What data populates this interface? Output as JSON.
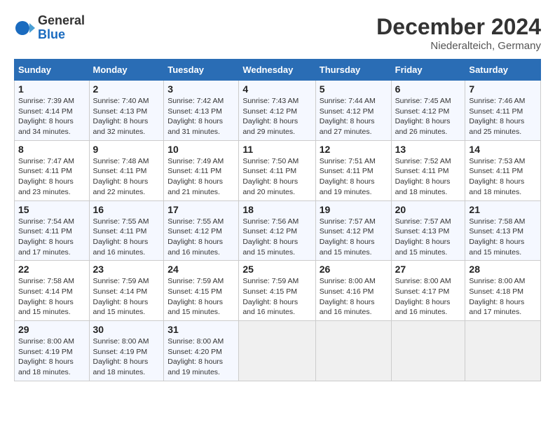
{
  "header": {
    "logo_general": "General",
    "logo_blue": "Blue",
    "month_year": "December 2024",
    "location": "Niederalteich, Germany"
  },
  "weekdays": [
    "Sunday",
    "Monday",
    "Tuesday",
    "Wednesday",
    "Thursday",
    "Friday",
    "Saturday"
  ],
  "weeks": [
    [
      {
        "day": 1,
        "sunrise": "7:39 AM",
        "sunset": "4:14 PM",
        "daylight": "8 hours and 34 minutes."
      },
      {
        "day": 2,
        "sunrise": "7:40 AM",
        "sunset": "4:13 PM",
        "daylight": "8 hours and 32 minutes."
      },
      {
        "day": 3,
        "sunrise": "7:42 AM",
        "sunset": "4:13 PM",
        "daylight": "8 hours and 31 minutes."
      },
      {
        "day": 4,
        "sunrise": "7:43 AM",
        "sunset": "4:12 PM",
        "daylight": "8 hours and 29 minutes."
      },
      {
        "day": 5,
        "sunrise": "7:44 AM",
        "sunset": "4:12 PM",
        "daylight": "8 hours and 27 minutes."
      },
      {
        "day": 6,
        "sunrise": "7:45 AM",
        "sunset": "4:12 PM",
        "daylight": "8 hours and 26 minutes."
      },
      {
        "day": 7,
        "sunrise": "7:46 AM",
        "sunset": "4:11 PM",
        "daylight": "8 hours and 25 minutes."
      }
    ],
    [
      {
        "day": 8,
        "sunrise": "7:47 AM",
        "sunset": "4:11 PM",
        "daylight": "8 hours and 23 minutes."
      },
      {
        "day": 9,
        "sunrise": "7:48 AM",
        "sunset": "4:11 PM",
        "daylight": "8 hours and 22 minutes."
      },
      {
        "day": 10,
        "sunrise": "7:49 AM",
        "sunset": "4:11 PM",
        "daylight": "8 hours and 21 minutes."
      },
      {
        "day": 11,
        "sunrise": "7:50 AM",
        "sunset": "4:11 PM",
        "daylight": "8 hours and 20 minutes."
      },
      {
        "day": 12,
        "sunrise": "7:51 AM",
        "sunset": "4:11 PM",
        "daylight": "8 hours and 19 minutes."
      },
      {
        "day": 13,
        "sunrise": "7:52 AM",
        "sunset": "4:11 PM",
        "daylight": "8 hours and 18 minutes."
      },
      {
        "day": 14,
        "sunrise": "7:53 AM",
        "sunset": "4:11 PM",
        "daylight": "8 hours and 18 minutes."
      }
    ],
    [
      {
        "day": 15,
        "sunrise": "7:54 AM",
        "sunset": "4:11 PM",
        "daylight": "8 hours and 17 minutes."
      },
      {
        "day": 16,
        "sunrise": "7:55 AM",
        "sunset": "4:11 PM",
        "daylight": "8 hours and 16 minutes."
      },
      {
        "day": 17,
        "sunrise": "7:55 AM",
        "sunset": "4:12 PM",
        "daylight": "8 hours and 16 minutes."
      },
      {
        "day": 18,
        "sunrise": "7:56 AM",
        "sunset": "4:12 PM",
        "daylight": "8 hours and 15 minutes."
      },
      {
        "day": 19,
        "sunrise": "7:57 AM",
        "sunset": "4:12 PM",
        "daylight": "8 hours and 15 minutes."
      },
      {
        "day": 20,
        "sunrise": "7:57 AM",
        "sunset": "4:13 PM",
        "daylight": "8 hours and 15 minutes."
      },
      {
        "day": 21,
        "sunrise": "7:58 AM",
        "sunset": "4:13 PM",
        "daylight": "8 hours and 15 minutes."
      }
    ],
    [
      {
        "day": 22,
        "sunrise": "7:58 AM",
        "sunset": "4:14 PM",
        "daylight": "8 hours and 15 minutes."
      },
      {
        "day": 23,
        "sunrise": "7:59 AM",
        "sunset": "4:14 PM",
        "daylight": "8 hours and 15 minutes."
      },
      {
        "day": 24,
        "sunrise": "7:59 AM",
        "sunset": "4:15 PM",
        "daylight": "8 hours and 15 minutes."
      },
      {
        "day": 25,
        "sunrise": "7:59 AM",
        "sunset": "4:15 PM",
        "daylight": "8 hours and 16 minutes."
      },
      {
        "day": 26,
        "sunrise": "8:00 AM",
        "sunset": "4:16 PM",
        "daylight": "8 hours and 16 minutes."
      },
      {
        "day": 27,
        "sunrise": "8:00 AM",
        "sunset": "4:17 PM",
        "daylight": "8 hours and 16 minutes."
      },
      {
        "day": 28,
        "sunrise": "8:00 AM",
        "sunset": "4:18 PM",
        "daylight": "8 hours and 17 minutes."
      }
    ],
    [
      {
        "day": 29,
        "sunrise": "8:00 AM",
        "sunset": "4:19 PM",
        "daylight": "8 hours and 18 minutes."
      },
      {
        "day": 30,
        "sunrise": "8:00 AM",
        "sunset": "4:19 PM",
        "daylight": "8 hours and 18 minutes."
      },
      {
        "day": 31,
        "sunrise": "8:00 AM",
        "sunset": "4:20 PM",
        "daylight": "8 hours and 19 minutes."
      },
      null,
      null,
      null,
      null
    ]
  ],
  "labels": {
    "sunrise": "Sunrise:",
    "sunset": "Sunset:",
    "daylight": "Daylight:"
  }
}
